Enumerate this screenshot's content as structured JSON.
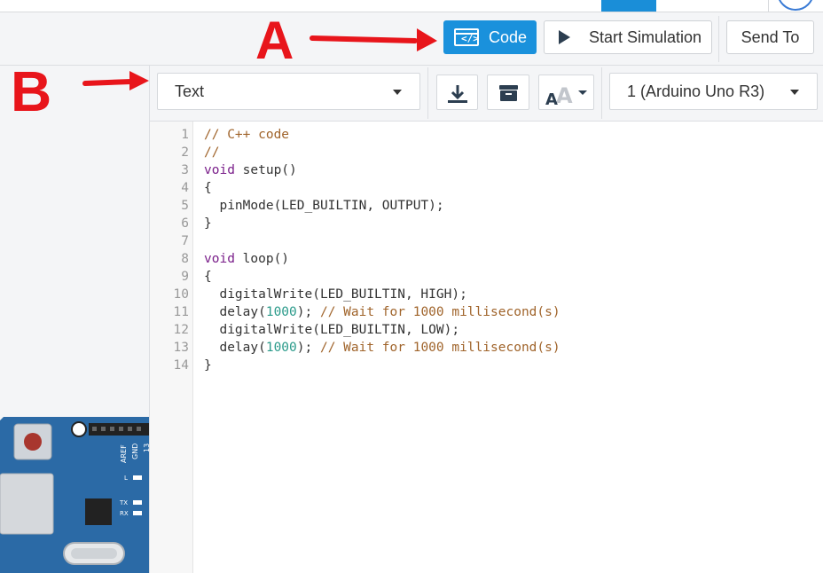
{
  "toolbar": {
    "code_label": "Code",
    "simulate_label": "Start Simulation",
    "send_label": "Send To"
  },
  "editor_bar": {
    "mode_value": "Text",
    "board_value": "1 (Arduino Uno R3)"
  },
  "code": {
    "line_numbers": [
      "1",
      "2",
      "3",
      "4",
      "5",
      "6",
      "7",
      "8",
      "9",
      "10",
      "11",
      "12",
      "13",
      "14"
    ]
  },
  "annotations": {
    "a_label": "A",
    "b_label": "B"
  },
  "board_labels": {
    "aref": "AREF",
    "gnd": "GND",
    "pin13": "13",
    "l": "L",
    "tx": "TX",
    "rx": "RX"
  },
  "colors": {
    "primary": "#1a91dc",
    "annotation": "#e8151b"
  },
  "icons": [
    "code-icon",
    "play-icon",
    "download-icon",
    "library-icon",
    "font-size-icon",
    "chevron-down-icon"
  ]
}
